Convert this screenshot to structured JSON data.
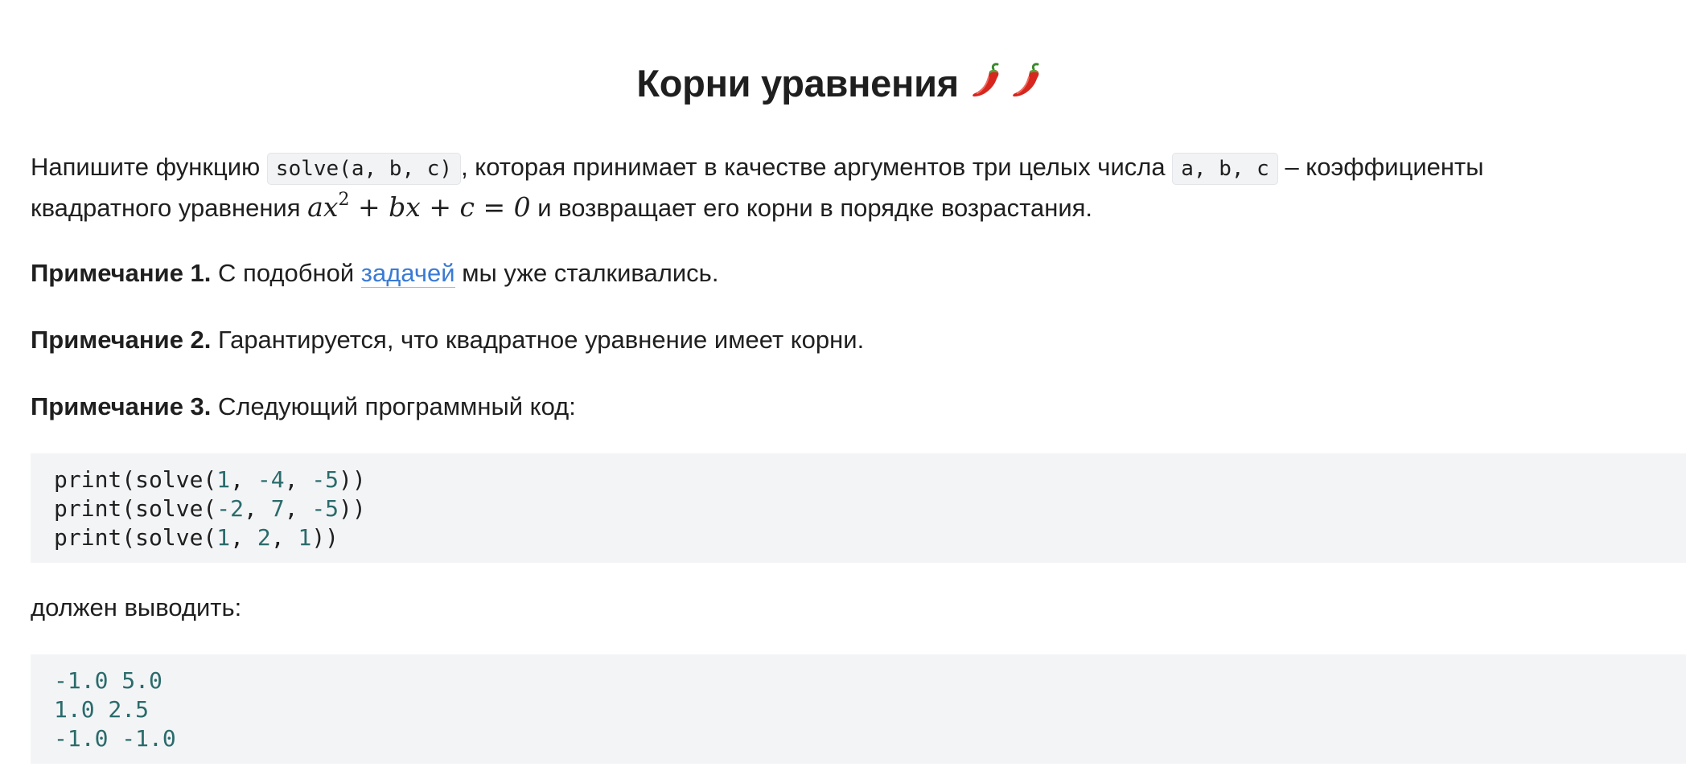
{
  "title": {
    "text": "Корни уравнения",
    "icons": [
      "chili-pepper-icon",
      "chili-pepper-icon"
    ]
  },
  "statement": {
    "line1_pre": "Напишите функцию",
    "func_code": "solve(a, b, c)",
    "line1_mid": ", которая принимает в качестве аргументов три целых числа",
    "args_code": "a, b, c",
    "line1_post": "– коэффициенты",
    "line2_pre": "квадратного уравнения",
    "equation": {
      "a": "ax",
      "exp": "2",
      "rest": "+ bx + c = 0"
    },
    "line2_post": "и возвращает его корни в порядке возрастания."
  },
  "notes": [
    {
      "label": "Примечание 1.",
      "pre": "С подобной",
      "link": "задачей",
      "post": "мы уже сталкивались."
    },
    {
      "label": "Примечание 2.",
      "text": "Гарантируется, что квадратное уравнение имеет корни."
    },
    {
      "label": "Примечание 3.",
      "text": "Следующий программный код:"
    }
  ],
  "code_example": {
    "lines": [
      {
        "prefix": "print(solve(",
        "args": [
          "1",
          "-4",
          "-5"
        ],
        "suffix": "))"
      },
      {
        "prefix": "print(solve(",
        "args": [
          "-2",
          "7",
          "-5"
        ],
        "suffix": "))"
      },
      {
        "prefix": "print(solve(",
        "args": [
          "1",
          "2",
          "1"
        ],
        "suffix": "))"
      }
    ]
  },
  "output_label": "должен выводить:",
  "output_example": {
    "lines": [
      "-1.0 5.0",
      "1.0 2.5",
      "-1.0 -1.0"
    ]
  },
  "colors": {
    "link": "#3a7bd5",
    "code_background": "#f3f4f6",
    "number": "#2a6b6b"
  }
}
